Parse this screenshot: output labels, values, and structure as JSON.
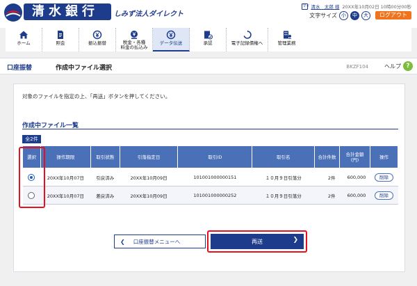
{
  "header": {
    "bank_name": "清水銀行",
    "service_name": "しみず法人ダイレクト",
    "user_icon": "マイ",
    "user_name": "清水　太郎 様",
    "last_login": "20XX年10月02日 10時00分00秒",
    "font_size_label": "文字サイズ",
    "font_sizes": [
      "小",
      "中",
      "大"
    ],
    "logout_label": "ログアウト"
  },
  "nav": {
    "items": [
      {
        "label": "ホーム",
        "icon": "home-icon"
      },
      {
        "label": "照会",
        "icon": "document-icon"
      },
      {
        "label": "振込振替",
        "icon": "yen-transfer-icon"
      },
      {
        "label": "税金・各種\n料金の払込み",
        "icon": "tax-payment-icon"
      },
      {
        "label": "データ伝送",
        "icon": "data-transmission-icon"
      },
      {
        "label": "承認",
        "icon": "approval-icon"
      },
      {
        "label": "電子記録債権へ",
        "icon": "electronic-claims-icon"
      },
      {
        "label": "管理業務",
        "icon": "management-icon"
      }
    ]
  },
  "title_bar": {
    "category": "口座振替",
    "title": "作成中ファイル選択",
    "screen_id": "BKZF104",
    "help_label": "ヘルプ",
    "help_icon": "?"
  },
  "content": {
    "instruction": "対象のファイルを指定の上、「再送」ボタンを押してください。",
    "section_title": "作成中ファイル一覧",
    "count_badge": "全2件",
    "table": {
      "headers": [
        "選択",
        "操作期限",
        "取引状態",
        "引落指定日",
        "取引ID",
        "取引名",
        "合計件数",
        "合計金額\n(円)",
        "操作"
      ],
      "rows": [
        {
          "selected": true,
          "deadline": "20XX年10月07日",
          "status": "引戻済み",
          "debit_date": "20XX年10月09日",
          "id": "101001000000151",
          "name": "１０月９日引落分",
          "count": "2件",
          "amount": "600,000",
          "action": "削除"
        },
        {
          "selected": false,
          "deadline": "20XX年10月07日",
          "status": "差戻済み",
          "debit_date": "20XX年10月09日",
          "id": "101001000000252",
          "name": "１０月９日引落分",
          "count": "2件",
          "amount": "600,000",
          "action": "削除"
        }
      ]
    },
    "back_button": "口座振替メニューへ",
    "send_button": "再送"
  },
  "colors": {
    "brand": "#1e3c8c",
    "header_table": "#4a70b8",
    "logout": "#f0741e",
    "highlight": "#e8101e",
    "help": "#7dbd3c"
  }
}
